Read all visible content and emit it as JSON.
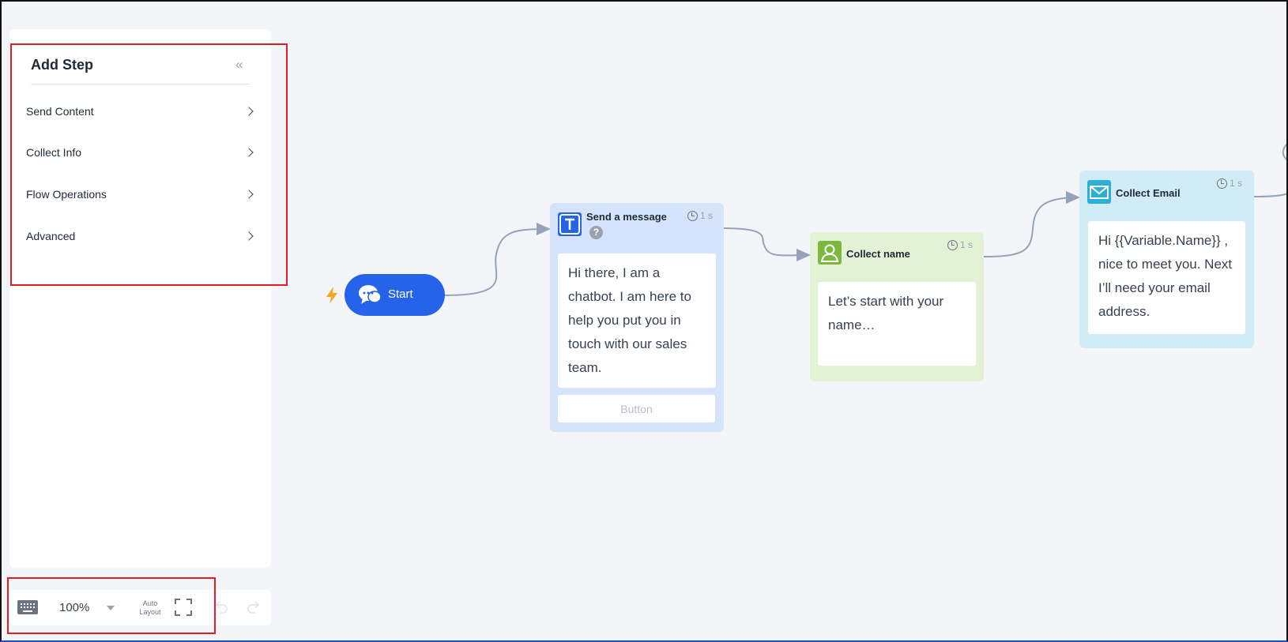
{
  "sidebar": {
    "title": "Add Step",
    "collapse_icon": "«",
    "items": [
      {
        "label": "Send Content"
      },
      {
        "label": "Collect Info"
      },
      {
        "label": "Flow Operations"
      },
      {
        "label": "Advanced"
      }
    ]
  },
  "toolbar": {
    "zoom": "100%",
    "auto_layout_line1": "Auto",
    "auto_layout_line2": "Layout"
  },
  "flow": {
    "start": {
      "label": "Start"
    },
    "nodes": [
      {
        "title": "Send a message",
        "delay": "1 s",
        "help": "?",
        "text": "Hi there, I am a chatbot. I am here to help you put you in touch with our sales team.",
        "button": "Button",
        "color": "#d6e4fb",
        "icon_color": "#2563eb"
      },
      {
        "title": "Collect name",
        "delay": "1 s",
        "text": "Let’s start with your name…",
        "color": "#e3f2d4",
        "icon_color": "#7cb83d"
      },
      {
        "title": "Collect Email",
        "delay": "1 s",
        "text": "Hi {{Variable.Name}} , nice to meet you. Next I’ll need your email address.",
        "color": "#d2ecf6",
        "icon_color": "#2bb0d8"
      }
    ]
  },
  "colors": {
    "highlight": "#e11d24",
    "accent": "#2563eb",
    "bolt": "#f5a623"
  }
}
